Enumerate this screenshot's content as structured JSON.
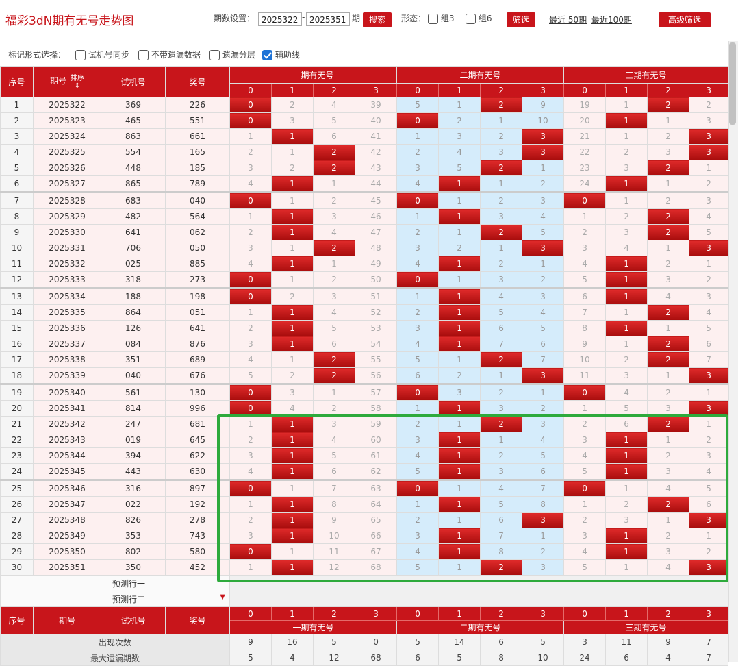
{
  "title": "福彩3dN期有无号走势图",
  "toolbar": {
    "period_label": "期数设置：",
    "from": "2025322",
    "dash": "-",
    "to": "2025351",
    "unit": "期",
    "search": "搜索",
    "form_label": "形态：",
    "zu3": "组3",
    "zu6": "组6",
    "filter": "筛选",
    "recent50": "最近 50期",
    "recent100": "最近100期",
    "advanced": "高级筛选"
  },
  "markbar": {
    "label": "标记形式选择：",
    "opt1": "试机号同步",
    "opt2": "不带遗漏数据",
    "opt3": "遗漏分层",
    "opt4": "辅助线"
  },
  "headers": {
    "seq": "序号",
    "period": "期号",
    "sort": "排序",
    "trial": "试机号",
    "prize": "奖号",
    "group1": "一期有无号",
    "group2": "二期有无号",
    "group3": "三期有无号",
    "digits": [
      "0",
      "1",
      "2",
      "3"
    ]
  },
  "rows": [
    {
      "seq": "1",
      "period": "2025322",
      "trial": "369",
      "prize": "226",
      "g1": [
        "0",
        "2",
        "4",
        "39"
      ],
      "g2": [
        "5",
        "1",
        "2",
        "9"
      ],
      "g3": [
        "19",
        "1",
        "2",
        "2"
      ],
      "h1": [
        1,
        0,
        0,
        0
      ],
      "h2": [
        0,
        0,
        1,
        0
      ],
      "h3": [
        0,
        0,
        1,
        0
      ]
    },
    {
      "seq": "2",
      "period": "2025323",
      "trial": "465",
      "prize": "551",
      "g1": [
        "0",
        "3",
        "5",
        "40"
      ],
      "g2": [
        "0",
        "2",
        "1",
        "10"
      ],
      "g3": [
        "20",
        "1",
        "1",
        "3"
      ],
      "h1": [
        1,
        0,
        0,
        0
      ],
      "h2": [
        1,
        0,
        0,
        0
      ],
      "h3": [
        0,
        1,
        0,
        0
      ]
    },
    {
      "seq": "3",
      "period": "2025324",
      "trial": "863",
      "prize": "661",
      "g1": [
        "1",
        "1",
        "6",
        "41"
      ],
      "g2": [
        "1",
        "3",
        "2",
        "3"
      ],
      "g3": [
        "21",
        "1",
        "2",
        "3"
      ],
      "h1": [
        0,
        1,
        0,
        0
      ],
      "h2": [
        0,
        0,
        0,
        1
      ],
      "h3": [
        0,
        0,
        0,
        1
      ]
    },
    {
      "seq": "4",
      "period": "2025325",
      "trial": "554",
      "prize": "165",
      "g1": [
        "2",
        "1",
        "2",
        "42"
      ],
      "g2": [
        "2",
        "4",
        "3",
        "3"
      ],
      "g3": [
        "22",
        "2",
        "3",
        "3"
      ],
      "h1": [
        0,
        0,
        1,
        0
      ],
      "h2": [
        0,
        0,
        0,
        1
      ],
      "h3": [
        0,
        0,
        0,
        1
      ]
    },
    {
      "seq": "5",
      "period": "2025326",
      "trial": "448",
      "prize": "185",
      "g1": [
        "3",
        "2",
        "2",
        "43"
      ],
      "g2": [
        "3",
        "5",
        "2",
        "1"
      ],
      "g3": [
        "23",
        "3",
        "2",
        "1"
      ],
      "h1": [
        0,
        0,
        1,
        0
      ],
      "h2": [
        0,
        0,
        1,
        0
      ],
      "h3": [
        0,
        0,
        1,
        0
      ]
    },
    {
      "seq": "6",
      "period": "2025327",
      "trial": "865",
      "prize": "789",
      "g1": [
        "4",
        "1",
        "1",
        "44"
      ],
      "g2": [
        "4",
        "1",
        "1",
        "2"
      ],
      "g3": [
        "24",
        "1",
        "1",
        "2"
      ],
      "h1": [
        0,
        1,
        0,
        0
      ],
      "h2": [
        0,
        1,
        0,
        0
      ],
      "h3": [
        0,
        1,
        0,
        0
      ]
    },
    {
      "seq": "7",
      "period": "2025328",
      "trial": "683",
      "prize": "040",
      "g1": [
        "0",
        "1",
        "2",
        "45"
      ],
      "g2": [
        "0",
        "1",
        "2",
        "3"
      ],
      "g3": [
        "0",
        "1",
        "2",
        "3"
      ],
      "h1": [
        1,
        0,
        0,
        0
      ],
      "h2": [
        1,
        0,
        0,
        0
      ],
      "h3": [
        1,
        0,
        0,
        0
      ]
    },
    {
      "seq": "8",
      "period": "2025329",
      "trial": "482",
      "prize": "564",
      "g1": [
        "1",
        "1",
        "3",
        "46"
      ],
      "g2": [
        "1",
        "1",
        "3",
        "4"
      ],
      "g3": [
        "1",
        "2",
        "2",
        "4"
      ],
      "h1": [
        0,
        1,
        0,
        0
      ],
      "h2": [
        0,
        1,
        0,
        0
      ],
      "h3": [
        0,
        0,
        1,
        0
      ]
    },
    {
      "seq": "9",
      "period": "2025330",
      "trial": "641",
      "prize": "062",
      "g1": [
        "2",
        "1",
        "4",
        "47"
      ],
      "g2": [
        "2",
        "1",
        "2",
        "5"
      ],
      "g3": [
        "2",
        "3",
        "2",
        "5"
      ],
      "h1": [
        0,
        1,
        0,
        0
      ],
      "h2": [
        0,
        0,
        1,
        0
      ],
      "h3": [
        0,
        0,
        1,
        0
      ]
    },
    {
      "seq": "10",
      "period": "2025331",
      "trial": "706",
      "prize": "050",
      "g1": [
        "3",
        "1",
        "2",
        "48"
      ],
      "g2": [
        "3",
        "2",
        "1",
        "3"
      ],
      "g3": [
        "3",
        "4",
        "1",
        "3"
      ],
      "h1": [
        0,
        0,
        1,
        0
      ],
      "h2": [
        0,
        0,
        0,
        1
      ],
      "h3": [
        0,
        0,
        0,
        1
      ]
    },
    {
      "seq": "11",
      "period": "2025332",
      "trial": "025",
      "prize": "885",
      "g1": [
        "4",
        "1",
        "1",
        "49"
      ],
      "g2": [
        "4",
        "1",
        "2",
        "1"
      ],
      "g3": [
        "4",
        "1",
        "2",
        "1"
      ],
      "h1": [
        0,
        1,
        0,
        0
      ],
      "h2": [
        0,
        1,
        0,
        0
      ],
      "h3": [
        0,
        1,
        0,
        0
      ]
    },
    {
      "seq": "12",
      "period": "2025333",
      "trial": "318",
      "prize": "273",
      "g1": [
        "0",
        "1",
        "2",
        "50"
      ],
      "g2": [
        "0",
        "1",
        "3",
        "2"
      ],
      "g3": [
        "5",
        "1",
        "3",
        "2"
      ],
      "h1": [
        1,
        0,
        0,
        0
      ],
      "h2": [
        1,
        0,
        0,
        0
      ],
      "h3": [
        0,
        1,
        0,
        0
      ]
    },
    {
      "seq": "13",
      "period": "2025334",
      "trial": "188",
      "prize": "198",
      "g1": [
        "0",
        "2",
        "3",
        "51"
      ],
      "g2": [
        "1",
        "1",
        "4",
        "3"
      ],
      "g3": [
        "6",
        "1",
        "4",
        "3"
      ],
      "h1": [
        1,
        0,
        0,
        0
      ],
      "h2": [
        0,
        1,
        0,
        0
      ],
      "h3": [
        0,
        1,
        0,
        0
      ]
    },
    {
      "seq": "14",
      "period": "2025335",
      "trial": "864",
      "prize": "051",
      "g1": [
        "1",
        "1",
        "4",
        "52"
      ],
      "g2": [
        "2",
        "1",
        "5",
        "4"
      ],
      "g3": [
        "7",
        "1",
        "2",
        "4"
      ],
      "h1": [
        0,
        1,
        0,
        0
      ],
      "h2": [
        0,
        1,
        0,
        0
      ],
      "h3": [
        0,
        0,
        1,
        0
      ]
    },
    {
      "seq": "15",
      "period": "2025336",
      "trial": "126",
      "prize": "641",
      "g1": [
        "2",
        "1",
        "5",
        "53"
      ],
      "g2": [
        "3",
        "1",
        "6",
        "5"
      ],
      "g3": [
        "8",
        "1",
        "1",
        "5"
      ],
      "h1": [
        0,
        1,
        0,
        0
      ],
      "h2": [
        0,
        1,
        0,
        0
      ],
      "h3": [
        0,
        1,
        0,
        0
      ]
    },
    {
      "seq": "16",
      "period": "2025337",
      "trial": "084",
      "prize": "876",
      "g1": [
        "3",
        "1",
        "6",
        "54"
      ],
      "g2": [
        "4",
        "1",
        "7",
        "6"
      ],
      "g3": [
        "9",
        "1",
        "2",
        "6"
      ],
      "h1": [
        0,
        1,
        0,
        0
      ],
      "h2": [
        0,
        1,
        0,
        0
      ],
      "h3": [
        0,
        0,
        1,
        0
      ]
    },
    {
      "seq": "17",
      "period": "2025338",
      "trial": "351",
      "prize": "689",
      "g1": [
        "4",
        "1",
        "2",
        "55"
      ],
      "g2": [
        "5",
        "1",
        "2",
        "7"
      ],
      "g3": [
        "10",
        "2",
        "2",
        "7"
      ],
      "h1": [
        0,
        0,
        1,
        0
      ],
      "h2": [
        0,
        0,
        1,
        0
      ],
      "h3": [
        0,
        0,
        1,
        0
      ]
    },
    {
      "seq": "18",
      "period": "2025339",
      "trial": "040",
      "prize": "676",
      "g1": [
        "5",
        "2",
        "2",
        "56"
      ],
      "g2": [
        "6",
        "2",
        "1",
        "3"
      ],
      "g3": [
        "11",
        "3",
        "1",
        "3"
      ],
      "h1": [
        0,
        0,
        1,
        0
      ],
      "h2": [
        0,
        0,
        0,
        1
      ],
      "h3": [
        0,
        0,
        0,
        1
      ]
    },
    {
      "seq": "19",
      "period": "2025340",
      "trial": "561",
      "prize": "130",
      "g1": [
        "0",
        "3",
        "1",
        "57"
      ],
      "g2": [
        "0",
        "3",
        "2",
        "1"
      ],
      "g3": [
        "0",
        "4",
        "2",
        "1"
      ],
      "h1": [
        1,
        0,
        0,
        0
      ],
      "h2": [
        1,
        0,
        0,
        0
      ],
      "h3": [
        1,
        0,
        0,
        0
      ]
    },
    {
      "seq": "20",
      "period": "2025341",
      "trial": "814",
      "prize": "996",
      "g1": [
        "0",
        "4",
        "2",
        "58"
      ],
      "g2": [
        "1",
        "1",
        "3",
        "2"
      ],
      "g3": [
        "1",
        "5",
        "3",
        "3"
      ],
      "h1": [
        1,
        0,
        0,
        0
      ],
      "h2": [
        0,
        1,
        0,
        0
      ],
      "h3": [
        0,
        0,
        0,
        1
      ]
    },
    {
      "seq": "21",
      "period": "2025342",
      "trial": "247",
      "prize": "681",
      "g1": [
        "1",
        "1",
        "3",
        "59"
      ],
      "g2": [
        "2",
        "1",
        "2",
        "3"
      ],
      "g3": [
        "2",
        "6",
        "2",
        "1"
      ],
      "h1": [
        0,
        1,
        0,
        0
      ],
      "h2": [
        0,
        0,
        1,
        0
      ],
      "h3": [
        0,
        0,
        1,
        0
      ]
    },
    {
      "seq": "22",
      "period": "2025343",
      "trial": "019",
      "prize": "645",
      "g1": [
        "2",
        "1",
        "4",
        "60"
      ],
      "g2": [
        "3",
        "1",
        "1",
        "4"
      ],
      "g3": [
        "3",
        "1",
        "1",
        "2"
      ],
      "h1": [
        0,
        1,
        0,
        0
      ],
      "h2": [
        0,
        1,
        0,
        0
      ],
      "h3": [
        0,
        1,
        0,
        0
      ]
    },
    {
      "seq": "23",
      "period": "2025344",
      "trial": "394",
      "prize": "622",
      "g1": [
        "3",
        "1",
        "5",
        "61"
      ],
      "g2": [
        "4",
        "1",
        "2",
        "5"
      ],
      "g3": [
        "4",
        "1",
        "2",
        "3"
      ],
      "h1": [
        0,
        1,
        0,
        0
      ],
      "h2": [
        0,
        1,
        0,
        0
      ],
      "h3": [
        0,
        1,
        0,
        0
      ]
    },
    {
      "seq": "24",
      "period": "2025345",
      "trial": "443",
      "prize": "630",
      "g1": [
        "4",
        "1",
        "6",
        "62"
      ],
      "g2": [
        "5",
        "1",
        "3",
        "6"
      ],
      "g3": [
        "5",
        "1",
        "3",
        "4"
      ],
      "h1": [
        0,
        1,
        0,
        0
      ],
      "h2": [
        0,
        1,
        0,
        0
      ],
      "h3": [
        0,
        1,
        0,
        0
      ]
    },
    {
      "seq": "25",
      "period": "2025346",
      "trial": "316",
      "prize": "897",
      "g1": [
        "0",
        "1",
        "7",
        "63"
      ],
      "g2": [
        "0",
        "1",
        "4",
        "7"
      ],
      "g3": [
        "0",
        "1",
        "4",
        "5"
      ],
      "h1": [
        1,
        0,
        0,
        0
      ],
      "h2": [
        1,
        0,
        0,
        0
      ],
      "h3": [
        1,
        0,
        0,
        0
      ]
    },
    {
      "seq": "26",
      "period": "2025347",
      "trial": "022",
      "prize": "192",
      "g1": [
        "1",
        "1",
        "8",
        "64"
      ],
      "g2": [
        "1",
        "1",
        "5",
        "8"
      ],
      "g3": [
        "1",
        "2",
        "2",
        "6"
      ],
      "h1": [
        0,
        1,
        0,
        0
      ],
      "h2": [
        0,
        1,
        0,
        0
      ],
      "h3": [
        0,
        0,
        1,
        0
      ]
    },
    {
      "seq": "27",
      "period": "2025348",
      "trial": "826",
      "prize": "278",
      "g1": [
        "2",
        "1",
        "9",
        "65"
      ],
      "g2": [
        "2",
        "1",
        "6",
        "3"
      ],
      "g3": [
        "2",
        "3",
        "1",
        "3"
      ],
      "h1": [
        0,
        1,
        0,
        0
      ],
      "h2": [
        0,
        0,
        0,
        1
      ],
      "h3": [
        0,
        0,
        0,
        1
      ]
    },
    {
      "seq": "28",
      "period": "2025349",
      "trial": "353",
      "prize": "743",
      "g1": [
        "3",
        "1",
        "10",
        "66"
      ],
      "g2": [
        "3",
        "1",
        "7",
        "1"
      ],
      "g3": [
        "3",
        "1",
        "2",
        "1"
      ],
      "h1": [
        0,
        1,
        0,
        0
      ],
      "h2": [
        0,
        1,
        0,
        0
      ],
      "h3": [
        0,
        1,
        0,
        0
      ]
    },
    {
      "seq": "29",
      "period": "2025350",
      "trial": "802",
      "prize": "580",
      "g1": [
        "0",
        "1",
        "11",
        "67"
      ],
      "g2": [
        "4",
        "1",
        "8",
        "2"
      ],
      "g3": [
        "4",
        "1",
        "3",
        "2"
      ],
      "h1": [
        1,
        0,
        0,
        0
      ],
      "h2": [
        0,
        1,
        0,
        0
      ],
      "h3": [
        0,
        1,
        0,
        0
      ]
    },
    {
      "seq": "30",
      "period": "2025351",
      "trial": "350",
      "prize": "452",
      "g1": [
        "1",
        "1",
        "12",
        "68"
      ],
      "g2": [
        "5",
        "1",
        "2",
        "3"
      ],
      "g3": [
        "5",
        "1",
        "4",
        "3"
      ],
      "h1": [
        0,
        1,
        0,
        0
      ],
      "h2": [
        0,
        0,
        1,
        0
      ],
      "h3": [
        0,
        0,
        0,
        1
      ]
    }
  ],
  "predict": {
    "row1": "预测行一",
    "row2": "预测行二"
  },
  "footer": {
    "occur_label": "出现次数",
    "occur": [
      "9",
      "16",
      "5",
      "0",
      "5",
      "14",
      "6",
      "5",
      "3",
      "11",
      "9",
      "7"
    ],
    "maxmiss_label": "最大遗漏期数",
    "maxmiss": [
      "5",
      "4",
      "12",
      "68",
      "6",
      "5",
      "8",
      "10",
      "24",
      "6",
      "4",
      "7"
    ]
  },
  "colors": {
    "brand_red": "#c8151b",
    "hit_red": "#d01b1b",
    "group2_bg": "#d5ecfb",
    "highlight_green": "#2eaa3c",
    "checkbox_blue": "#1e73d6"
  }
}
